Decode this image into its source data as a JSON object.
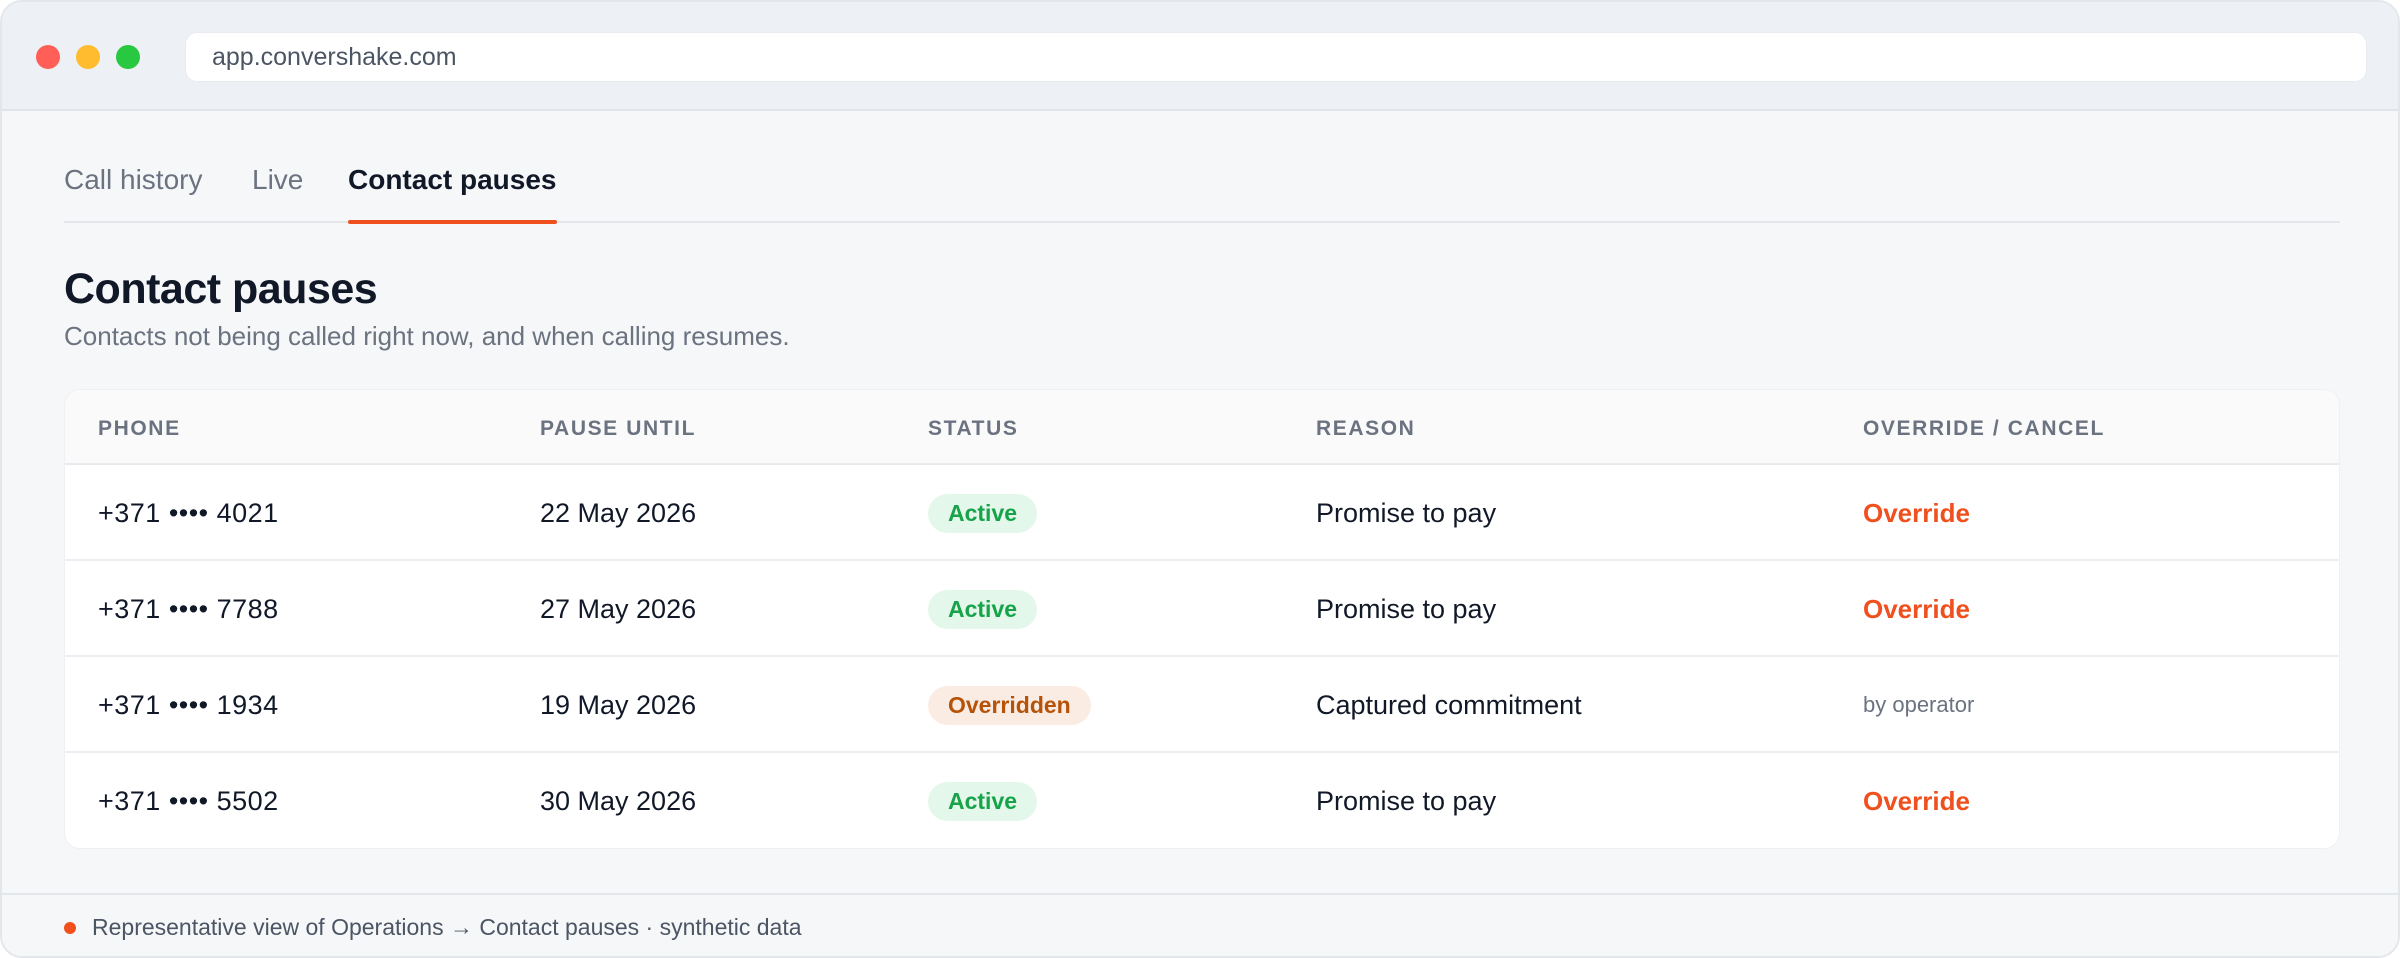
{
  "browser": {
    "url": "app.convershake.com"
  },
  "tabs": [
    {
      "label": "Call history"
    },
    {
      "label": "Live"
    },
    {
      "label": "Contact pauses",
      "active": true
    }
  ],
  "page": {
    "title": "Contact pauses",
    "subtitle": "Contacts not being called right now, and when calling resumes."
  },
  "table": {
    "columns": [
      "PHONE",
      "PAUSE UNTIL",
      "STATUS",
      "REASON",
      "OVERRIDE / CANCEL"
    ],
    "rows": [
      {
        "phone": "+371 •••• 4021",
        "pause_until": "22 May 2026",
        "status": "Active",
        "reason": "Promise to pay",
        "action": "Override"
      },
      {
        "phone": "+371 •••• 7788",
        "pause_until": "27 May 2026",
        "status": "Active",
        "reason": "Promise to pay",
        "action": "Override"
      },
      {
        "phone": "+371 •••• 1934",
        "pause_until": "19 May 2026",
        "status": "Overridden",
        "reason": "Captured commitment",
        "action_note": "by operator"
      },
      {
        "phone": "+371 •••• 5502",
        "pause_until": "30 May 2026",
        "status": "Active",
        "reason": "Promise to pay",
        "action": "Override"
      }
    ]
  },
  "footer": {
    "text": "Representative view of Operations → Contact pauses · synthetic data"
  },
  "colors": {
    "accent": "#f0501e",
    "active_badge_bg": "#e3f7ea",
    "active_badge_text": "#16a34a",
    "overridden_badge_bg": "#fbece3",
    "overridden_badge_text": "#b45309"
  }
}
